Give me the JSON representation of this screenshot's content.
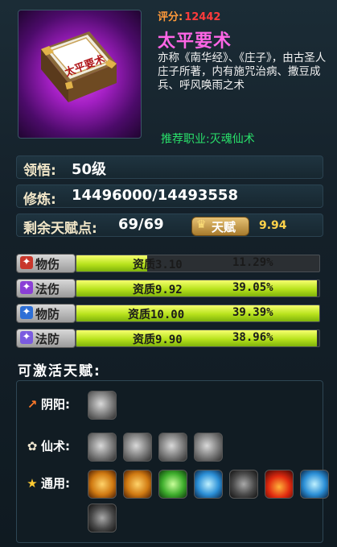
{
  "item": {
    "score_label": "评分:",
    "score_value": "12442",
    "title": "太平要术",
    "description": "亦称《南华经》、《庄子》，由古圣人庄子所著，内有施咒治病、撒豆成兵、呼风唤雨之术",
    "recommend": "推荐职业:灭魂仙术",
    "book_cover_text": "太平要术"
  },
  "stats": {
    "comprehension_label": "领悟:",
    "comprehension_value": "50级",
    "cultivation_label": "修炼:",
    "cultivation_value": "14496000/14493558",
    "talent_points_label": "剩余天赋点:",
    "talent_points_value": "69/69",
    "talent_button_label": "天赋",
    "talent_number": "9.94"
  },
  "attributes": [
    {
      "label": "物伤",
      "aptitude": "资质3.10",
      "percent": "11.29%",
      "fill": 0.29,
      "icon_color": "#c8372c",
      "icon": "sword-icon"
    },
    {
      "label": "法伤",
      "aptitude": "资质9.92",
      "percent": "39.05%",
      "fill": 0.99,
      "icon_color": "#8a3fd6",
      "icon": "magic-icon"
    },
    {
      "label": "物防",
      "aptitude": "资质10.00",
      "percent": "39.39%",
      "fill": 1.0,
      "icon_color": "#2d6fd6",
      "icon": "shield-icon"
    },
    {
      "label": "法防",
      "aptitude": "资质9.90",
      "percent": "38.96%",
      "fill": 0.99,
      "icon_color": "#7a5be0",
      "icon": "magic-shield-icon"
    }
  ],
  "talents": {
    "section_title": "可激活天赋:",
    "categories": [
      {
        "label": "阴阳:",
        "icon": "yinyang-icon",
        "skills": [
          "grey"
        ]
      },
      {
        "label": "仙术:",
        "icon": "immortal-art-icon",
        "skills": [
          "grey",
          "grey",
          "grey",
          "grey"
        ]
      },
      {
        "label": "通用:",
        "icon": "star-icon",
        "skills": [
          "gold",
          "gold",
          "green",
          "blue",
          "dark",
          "red",
          "blue",
          "dark"
        ]
      }
    ]
  }
}
